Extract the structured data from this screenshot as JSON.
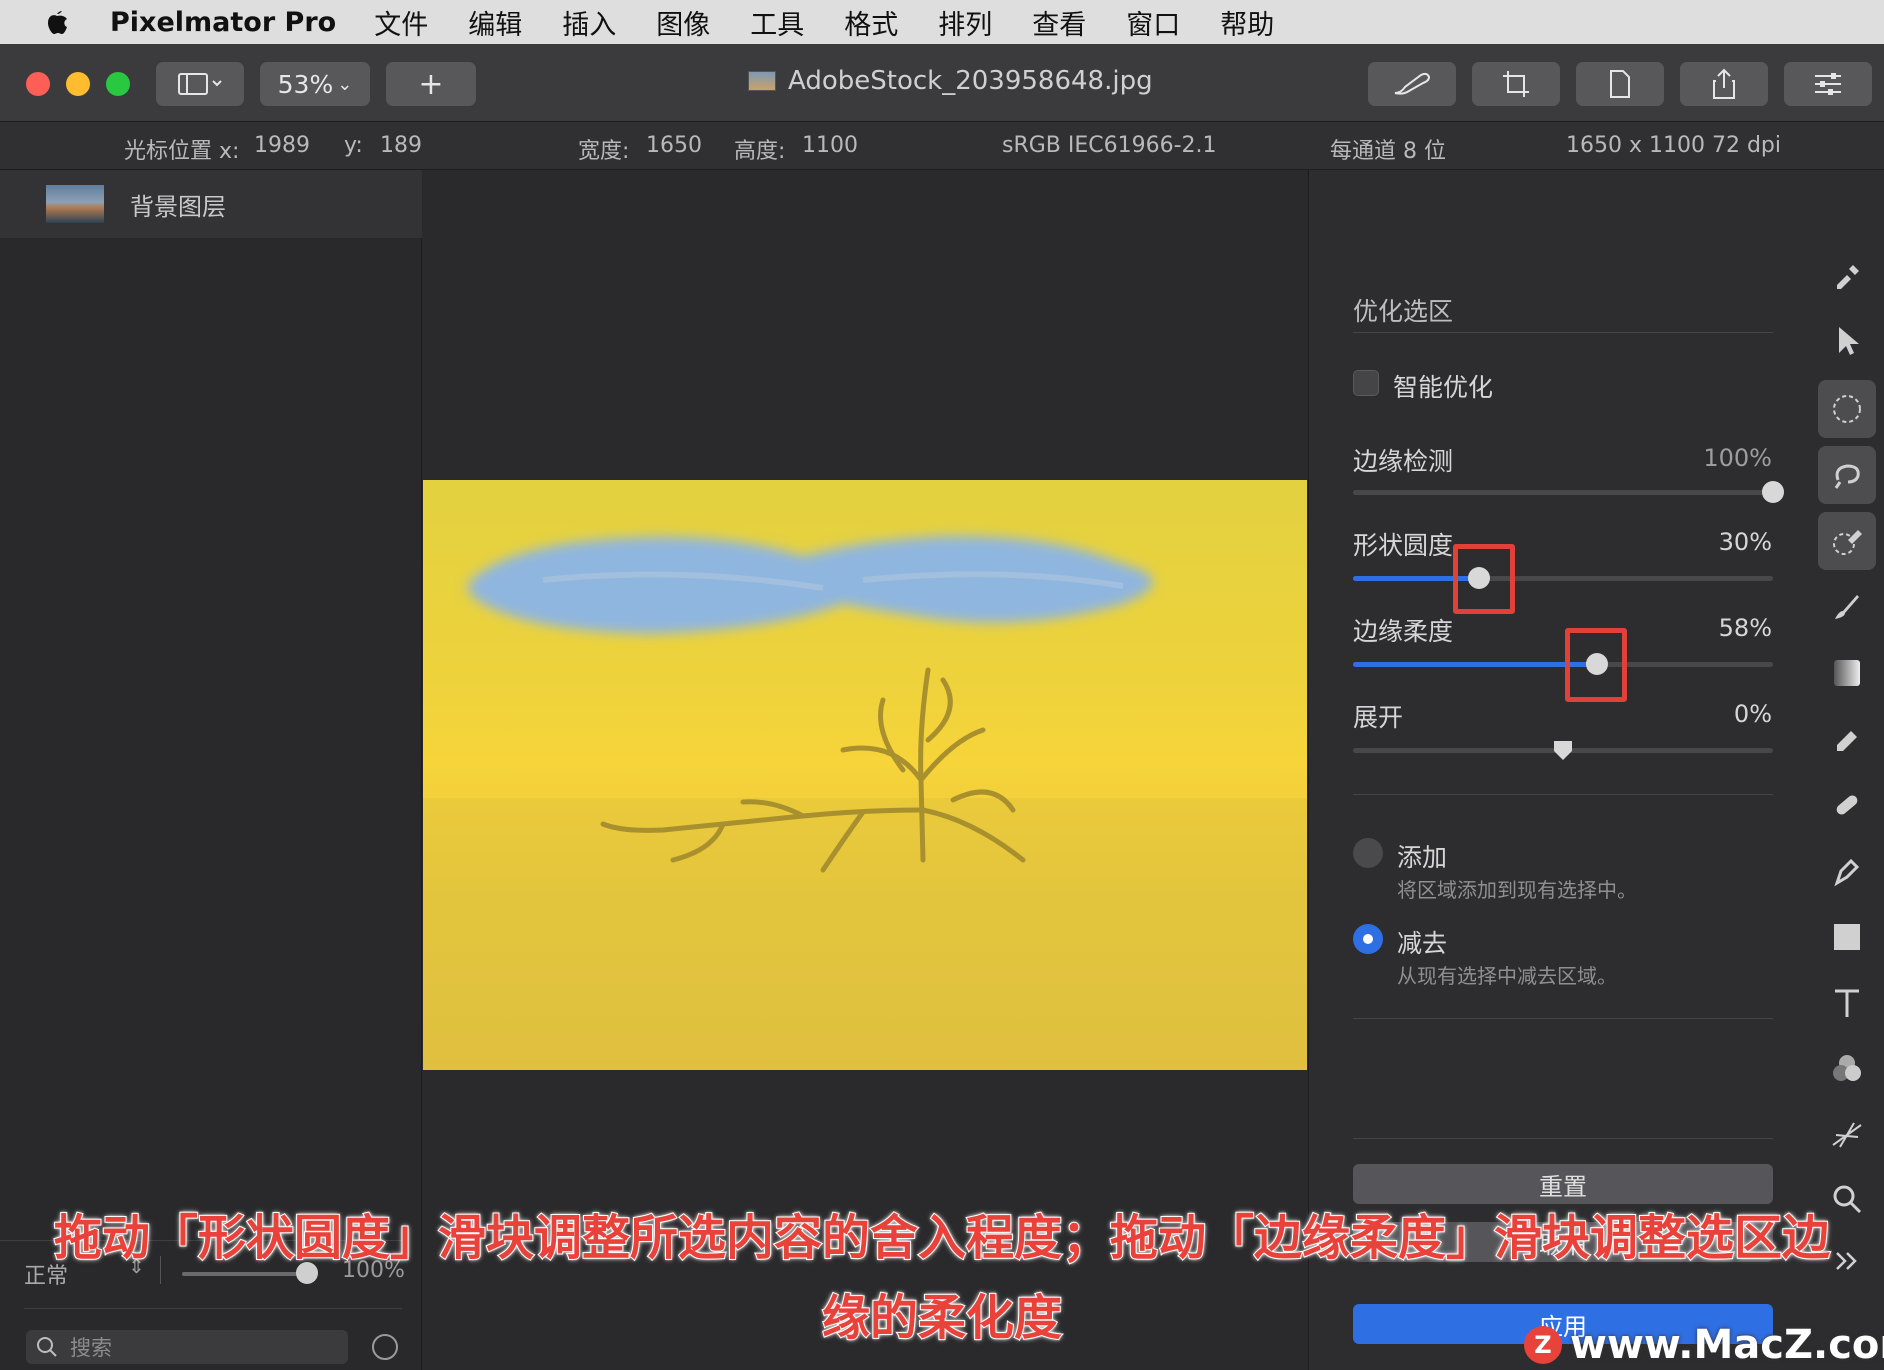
{
  "menubar": {
    "app_name": "Pixelmator Pro",
    "items": [
      "文件",
      "编辑",
      "插入",
      "图像",
      "工具",
      "格式",
      "排列",
      "查看",
      "窗口",
      "帮助"
    ]
  },
  "toolbar": {
    "zoom": "53%",
    "add_label": "+",
    "document_title": "AdobeStock_203958648.jpg"
  },
  "infobar": {
    "cursor_x_label": "光标位置 x:",
    "cursor_x": "1989",
    "cursor_y_label": "y:",
    "cursor_y": "189",
    "width_label": "宽度:",
    "width": "1650",
    "height_label": "高度:",
    "height": "1100",
    "color_profile": "sRGB IEC61966-2.1",
    "bit_depth": "每通道 8 位",
    "dimensions": "1650 x 1100 72 dpi"
  },
  "layers": {
    "items": [
      {
        "name": "背景图层"
      }
    ],
    "blend_mode": "正常",
    "opacity": "100%",
    "opacity_fraction": 1.0,
    "search_placeholder": "搜索"
  },
  "refine": {
    "title": "优化选区",
    "smart_refine_label": "智能优化",
    "smart_refine_checked": false,
    "sliders": [
      {
        "label": "边缘检测",
        "value": "100%",
        "fraction": 1.0,
        "disabled": true
      },
      {
        "label": "形状圆度",
        "value": "30%",
        "fraction": 0.3,
        "disabled": false
      },
      {
        "label": "边缘柔度",
        "value": "58%",
        "fraction": 0.58,
        "disabled": false
      },
      {
        "label": "展开",
        "value": "0%",
        "fraction": 0.5,
        "disabled": false
      }
    ],
    "modes": [
      {
        "label": "添加",
        "desc": "将区域添加到现有选择中。",
        "selected": false
      },
      {
        "label": "减去",
        "desc": "从现有选择中减去区域。",
        "selected": true
      }
    ],
    "reset_label": "重置",
    "cancel_label": "取消",
    "apply_label": "应用"
  },
  "caption": {
    "line1": "拖动「形状圆度」滑块调整所选内容的舍入程度；拖动「边缘柔度」滑块调整选区边",
    "line2": "缘的柔化度"
  },
  "watermark": {
    "logo": "Z",
    "text": "www.MacZ.com"
  },
  "colors": {
    "accent": "#2f6fe4",
    "highlight": "#e0423a",
    "overlay_yellow": "#f0d23a"
  }
}
